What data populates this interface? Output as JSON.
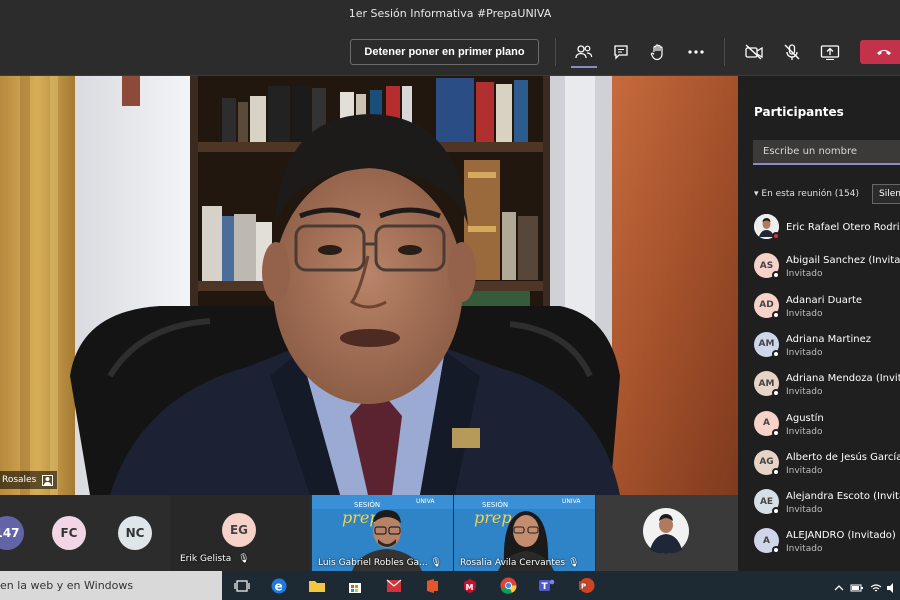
{
  "window": {
    "title": "1er Sesión Informativa #PrepaUNIVA"
  },
  "toolbar": {
    "stop_spotlight_label": "Detener poner en primer plano",
    "icons": [
      "participants-icon",
      "chat-icon",
      "raise-hand-icon",
      "more-icon",
      "camera-off-icon",
      "mic-off-icon",
      "share-icon",
      "hang-up-icon"
    ]
  },
  "main_video": {
    "name_tag": "Rosales"
  },
  "participants_panel": {
    "title": "Participantes",
    "search_placeholder": "Escribe un nombre",
    "in_meeting_label": "En esta reunión (154)",
    "mute_all_label": "Silen",
    "people": [
      {
        "initials": "",
        "name": "Eric Rafael Otero Rodrig",
        "role": "",
        "avatar_color": "#ffffff",
        "photo": true,
        "status": "red"
      },
      {
        "initials": "AS",
        "name": "Abigail Sanchez (Invitad",
        "role": "Invitado",
        "avatar_color": "#f6d2c9",
        "status": "white"
      },
      {
        "initials": "AD",
        "name": "Adanari Duarte",
        "role": "Invitado",
        "avatar_color": "#f6d2c9",
        "status": "white"
      },
      {
        "initials": "AM",
        "name": "Adriana Martinez",
        "role": "Invitado",
        "avatar_color": "#cfd6ea",
        "status": "white"
      },
      {
        "initials": "AM",
        "name": "Adriana Mendoza (Invit",
        "role": "Invitado",
        "avatar_color": "#e6d4c6",
        "status": "white"
      },
      {
        "initials": "A",
        "name": "Agustín",
        "role": "Invitado",
        "avatar_color": "#f6d2c9",
        "status": "white"
      },
      {
        "initials": "AG",
        "name": "Alberto de Jesús García",
        "role": "Invitado",
        "avatar_color": "#e6d4c6",
        "status": "white"
      },
      {
        "initials": "AE",
        "name": "Alejandra Escoto (Invita",
        "role": "Invitado",
        "avatar_color": "#d7dfe6",
        "status": "white"
      },
      {
        "initials": "A",
        "name": "ALEJANDRO (Invitado)",
        "role": "Invitado",
        "avatar_color": "#cfd6ea",
        "status": "white"
      }
    ]
  },
  "strip": {
    "avatars": [
      {
        "initials": "147",
        "color": "#6264a7",
        "text_color": "#ffffff"
      },
      {
        "initials": "FC",
        "color": "#f3d6e6",
        "text_color": "#333333"
      },
      {
        "initials": "NC",
        "color": "#dfe6ea",
        "text_color": "#333333"
      }
    ],
    "erik": {
      "initials": "EG",
      "name": "Erik Gelista",
      "color": "#f6d2c9"
    },
    "video_tiles": [
      {
        "name": "Luis Gabriel Robles Ga..."
      },
      {
        "name": "Rosalia Avila Cervantes"
      }
    ]
  },
  "taskbar": {
    "search_text": "en la web y en Windows"
  }
}
